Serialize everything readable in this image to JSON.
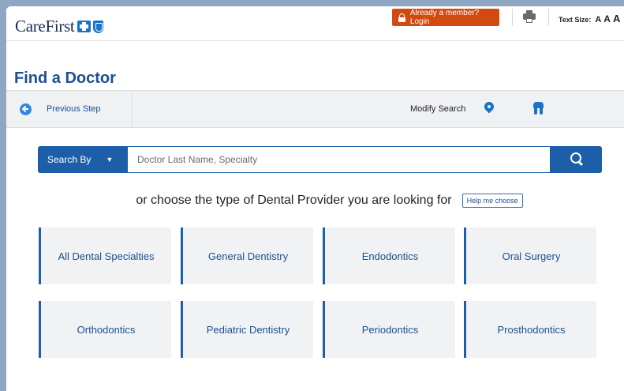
{
  "header": {
    "logo_text": "CareFirst",
    "login_label": "Already a member? Login",
    "text_size_label": "Text Size:",
    "text_size_options": [
      "A",
      "A",
      "A"
    ]
  },
  "page_title": "Find a Doctor",
  "step_bar": {
    "previous_label": "Previous Step",
    "modify_label": "Modify Search"
  },
  "search": {
    "by_label": "Search By",
    "caret": "▼",
    "placeholder": "Doctor Last Name, Specialty",
    "value": ""
  },
  "choose": {
    "text": "or choose the type of Dental Provider you are looking for",
    "help_label": "Help me choose"
  },
  "providers": [
    "All Dental Specialties",
    "General Dentistry",
    "Endodontics",
    "Oral Surgery",
    "Orthodontics",
    "Pediatric Dentistry",
    "Periodontics",
    "Prosthodontics"
  ],
  "colors": {
    "brand_blue": "#1d5ea9",
    "link_blue": "#1d4f91",
    "login_orange": "#d24a0f",
    "tile_bg": "#f1f2f4"
  }
}
